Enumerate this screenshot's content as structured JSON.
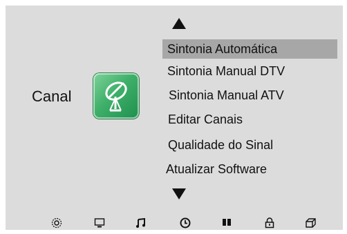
{
  "category": {
    "label": "Canal",
    "icon": "satellite-dish-icon",
    "icon_color": "#3fb06a"
  },
  "menu": {
    "selected_index": 0,
    "highlight_color": "#a7a7a7",
    "items": [
      {
        "label": "Sintonia Automática"
      },
      {
        "label": "Sintonia Manual DTV"
      },
      {
        "label": "Sintonia Manual ATV"
      },
      {
        "label": "Editar Canais"
      },
      {
        "label": "Qualidade do Sinal"
      },
      {
        "label": "Atualizar Software"
      }
    ]
  },
  "navigation": {
    "up_icon": "arrow-up-icon",
    "down_icon": "arrow-down-icon"
  },
  "bottom_icons": [
    "settings-gear-icon",
    "picture-monitor-icon",
    "sound-music-icon",
    "time-clock-icon",
    "channel-bars-icon",
    "lock-icon",
    "storage-icon"
  ]
}
